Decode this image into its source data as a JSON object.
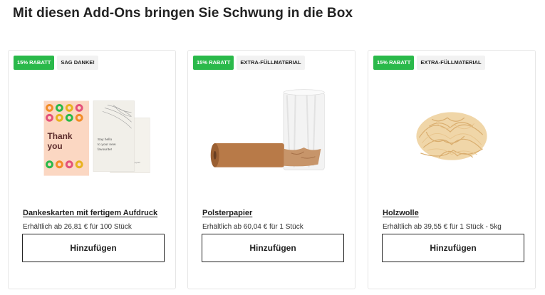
{
  "page": {
    "heading": "Mit diesen Add-Ons bringen Sie Schwung in die Box"
  },
  "cards": [
    {
      "discount_badge": "15% RABATT",
      "category_badge": "SAG DANKE!",
      "title": "Dankeskarten mit fertigem Aufdruck",
      "availability": "Erhältlich ab 26,81 € für 100 Stück",
      "button_label": "Hinzufügen",
      "image": {
        "card_front_text_1": "Thank",
        "card_front_text_2": "you",
        "card_middle_text": "Say hello to your new favourite!",
        "card_back_text": "Thank you for your support!"
      }
    },
    {
      "discount_badge": "15% RABATT",
      "category_badge": "EXTRA-FÜLLMATERIAL",
      "title": "Polsterpapier",
      "availability": "Erhältlich ab 60,04 € für 1 Stück",
      "button_label": "Hinzufügen"
    },
    {
      "discount_badge": "15% RABATT",
      "category_badge": "EXTRA-FÜLLMATERIAL",
      "title": "Holzwolle",
      "availability": "Erhältlich ab 39,55 € für 1 Stück - 5kg",
      "button_label": "Hinzufügen"
    }
  ],
  "colors": {
    "discount_badge_bg": "#2ab94a",
    "category_badge_bg": "#f2f2f2",
    "text": "#222222",
    "card_border": "#e6e6e6"
  }
}
